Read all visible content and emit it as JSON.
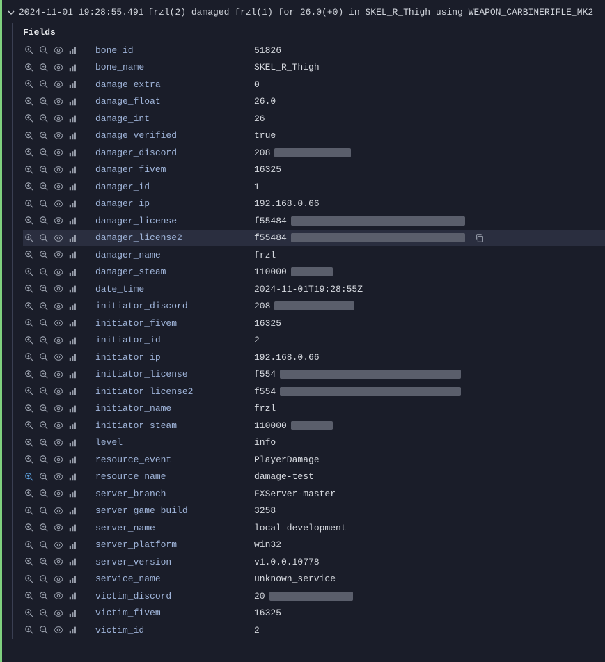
{
  "log": {
    "timestamp": "2024-11-01 19:28:55.491",
    "message": "frzl(2) damaged frzl(1) for 26.0(+0) in SKEL_R_Thigh using WEAPON_CARBINERIFLE_MK2"
  },
  "fields_header": "Fields",
  "fields": [
    {
      "key": "bone_id",
      "value": "51826"
    },
    {
      "key": "bone_name",
      "value": "SKEL_R_Thigh"
    },
    {
      "key": "damage_extra",
      "value": "0"
    },
    {
      "key": "damage_float",
      "value": "26.0"
    },
    {
      "key": "damage_int",
      "value": "26"
    },
    {
      "key": "damage_verified",
      "value": "true"
    },
    {
      "key": "damager_discord",
      "value": "208",
      "redact_w": 110
    },
    {
      "key": "damager_fivem",
      "value": "16325"
    },
    {
      "key": "damager_id",
      "value": "1"
    },
    {
      "key": "damager_ip",
      "value": "192.168.0.66"
    },
    {
      "key": "damager_license",
      "value": "f55484",
      "redact_w": 250
    },
    {
      "key": "damager_license2",
      "value": "f55484",
      "redact_w": 250,
      "hovered": true,
      "copy": true
    },
    {
      "key": "damager_name",
      "value": "frzl"
    },
    {
      "key": "damager_steam",
      "value": "110000",
      "redact_w": 60
    },
    {
      "key": "date_time",
      "value": "2024-11-01T19:28:55Z"
    },
    {
      "key": "initiator_discord",
      "value": "208",
      "redact_w": 115
    },
    {
      "key": "initiator_fivem",
      "value": "16325"
    },
    {
      "key": "initiator_id",
      "value": "2"
    },
    {
      "key": "initiator_ip",
      "value": "192.168.0.66"
    },
    {
      "key": "initiator_license",
      "value": "f554",
      "redact_w": 260
    },
    {
      "key": "initiator_license2",
      "value": "f554",
      "redact_w": 260
    },
    {
      "key": "initiator_name",
      "value": "frzl"
    },
    {
      "key": "initiator_steam",
      "value": "110000",
      "redact_w": 60
    },
    {
      "key": "level",
      "value": "info"
    },
    {
      "key": "resource_event",
      "value": "PlayerDamage"
    },
    {
      "key": "resource_name",
      "value": "damage-test",
      "zoom_active": true
    },
    {
      "key": "server_branch",
      "value": "FXServer-master"
    },
    {
      "key": "server_game_build",
      "value": "3258"
    },
    {
      "key": "server_name",
      "value": "local development"
    },
    {
      "key": "server_platform",
      "value": "win32"
    },
    {
      "key": "server_version",
      "value": "v1.0.0.10778"
    },
    {
      "key": "service_name",
      "value": "unknown_service"
    },
    {
      "key": "victim_discord",
      "value": "20",
      "redact_w": 120
    },
    {
      "key": "victim_fivem",
      "value": "16325"
    },
    {
      "key": "victim_id",
      "value": "2"
    }
  ]
}
